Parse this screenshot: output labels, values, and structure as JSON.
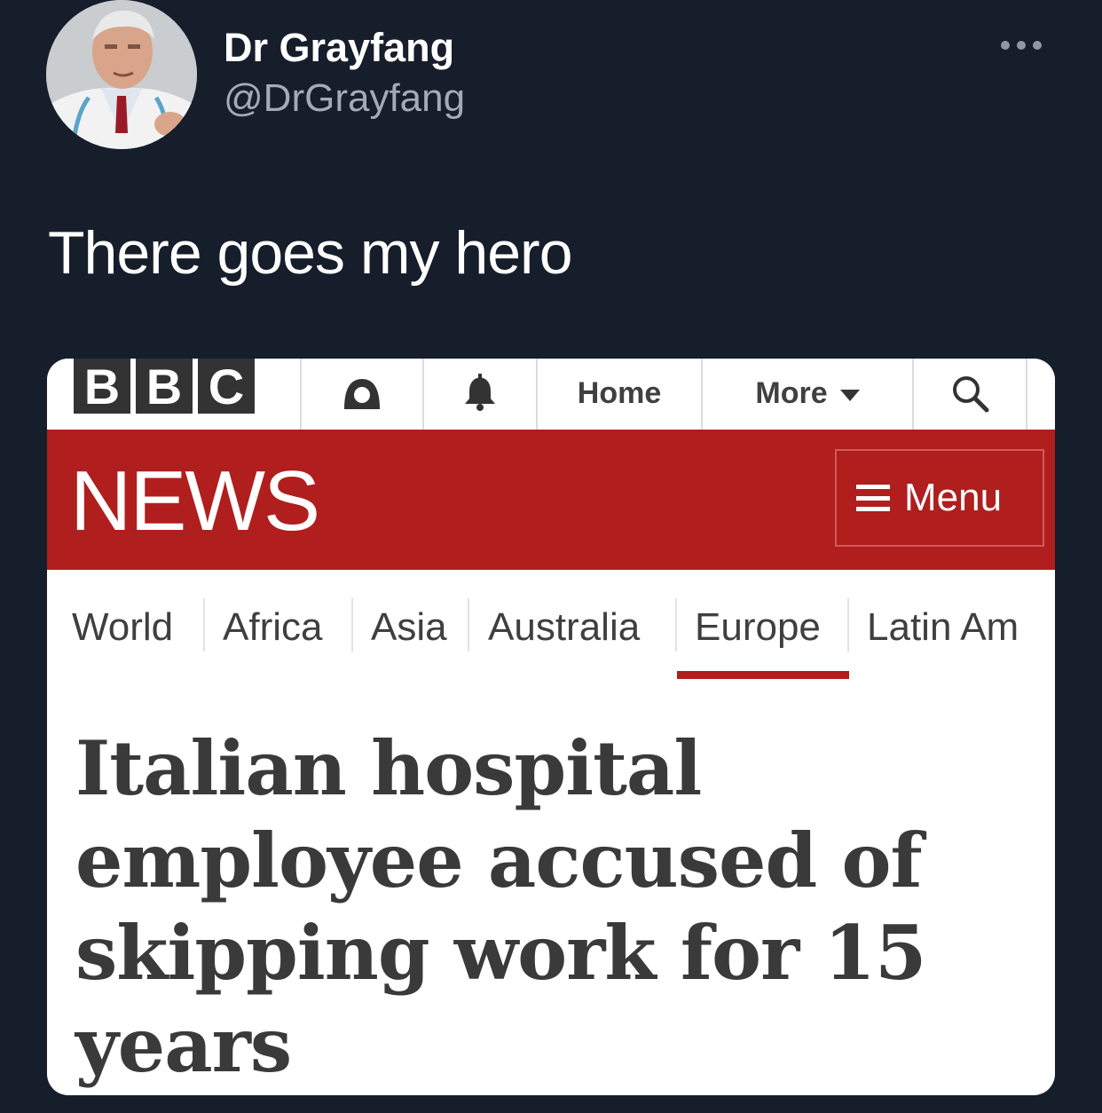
{
  "tweet": {
    "display_name": "Dr Grayfang",
    "handle": "@DrGrayfang",
    "text": "There goes my hero",
    "avatar_icon": "doctor-portrait",
    "more_icon": "more-options-icon"
  },
  "bbc": {
    "logo_letters": [
      "B",
      "B",
      "C"
    ],
    "nav": {
      "home_label": "Home",
      "more_label": "More",
      "account_icon": "account-icon",
      "notifications_icon": "bell-icon",
      "search_icon": "search-icon"
    },
    "section_title": "NEWS",
    "menu_label": "Menu",
    "subnav": [
      "World",
      "Africa",
      "Asia",
      "Australia",
      "Europe",
      "Latin Am"
    ],
    "active_subnav": "Europe",
    "headline": "Italian hospital employee accused of skipping work for 15 years",
    "colors": {
      "brand_red": "#b01e1e",
      "logo_block": "#333333",
      "tweet_background": "#161d2b"
    }
  }
}
